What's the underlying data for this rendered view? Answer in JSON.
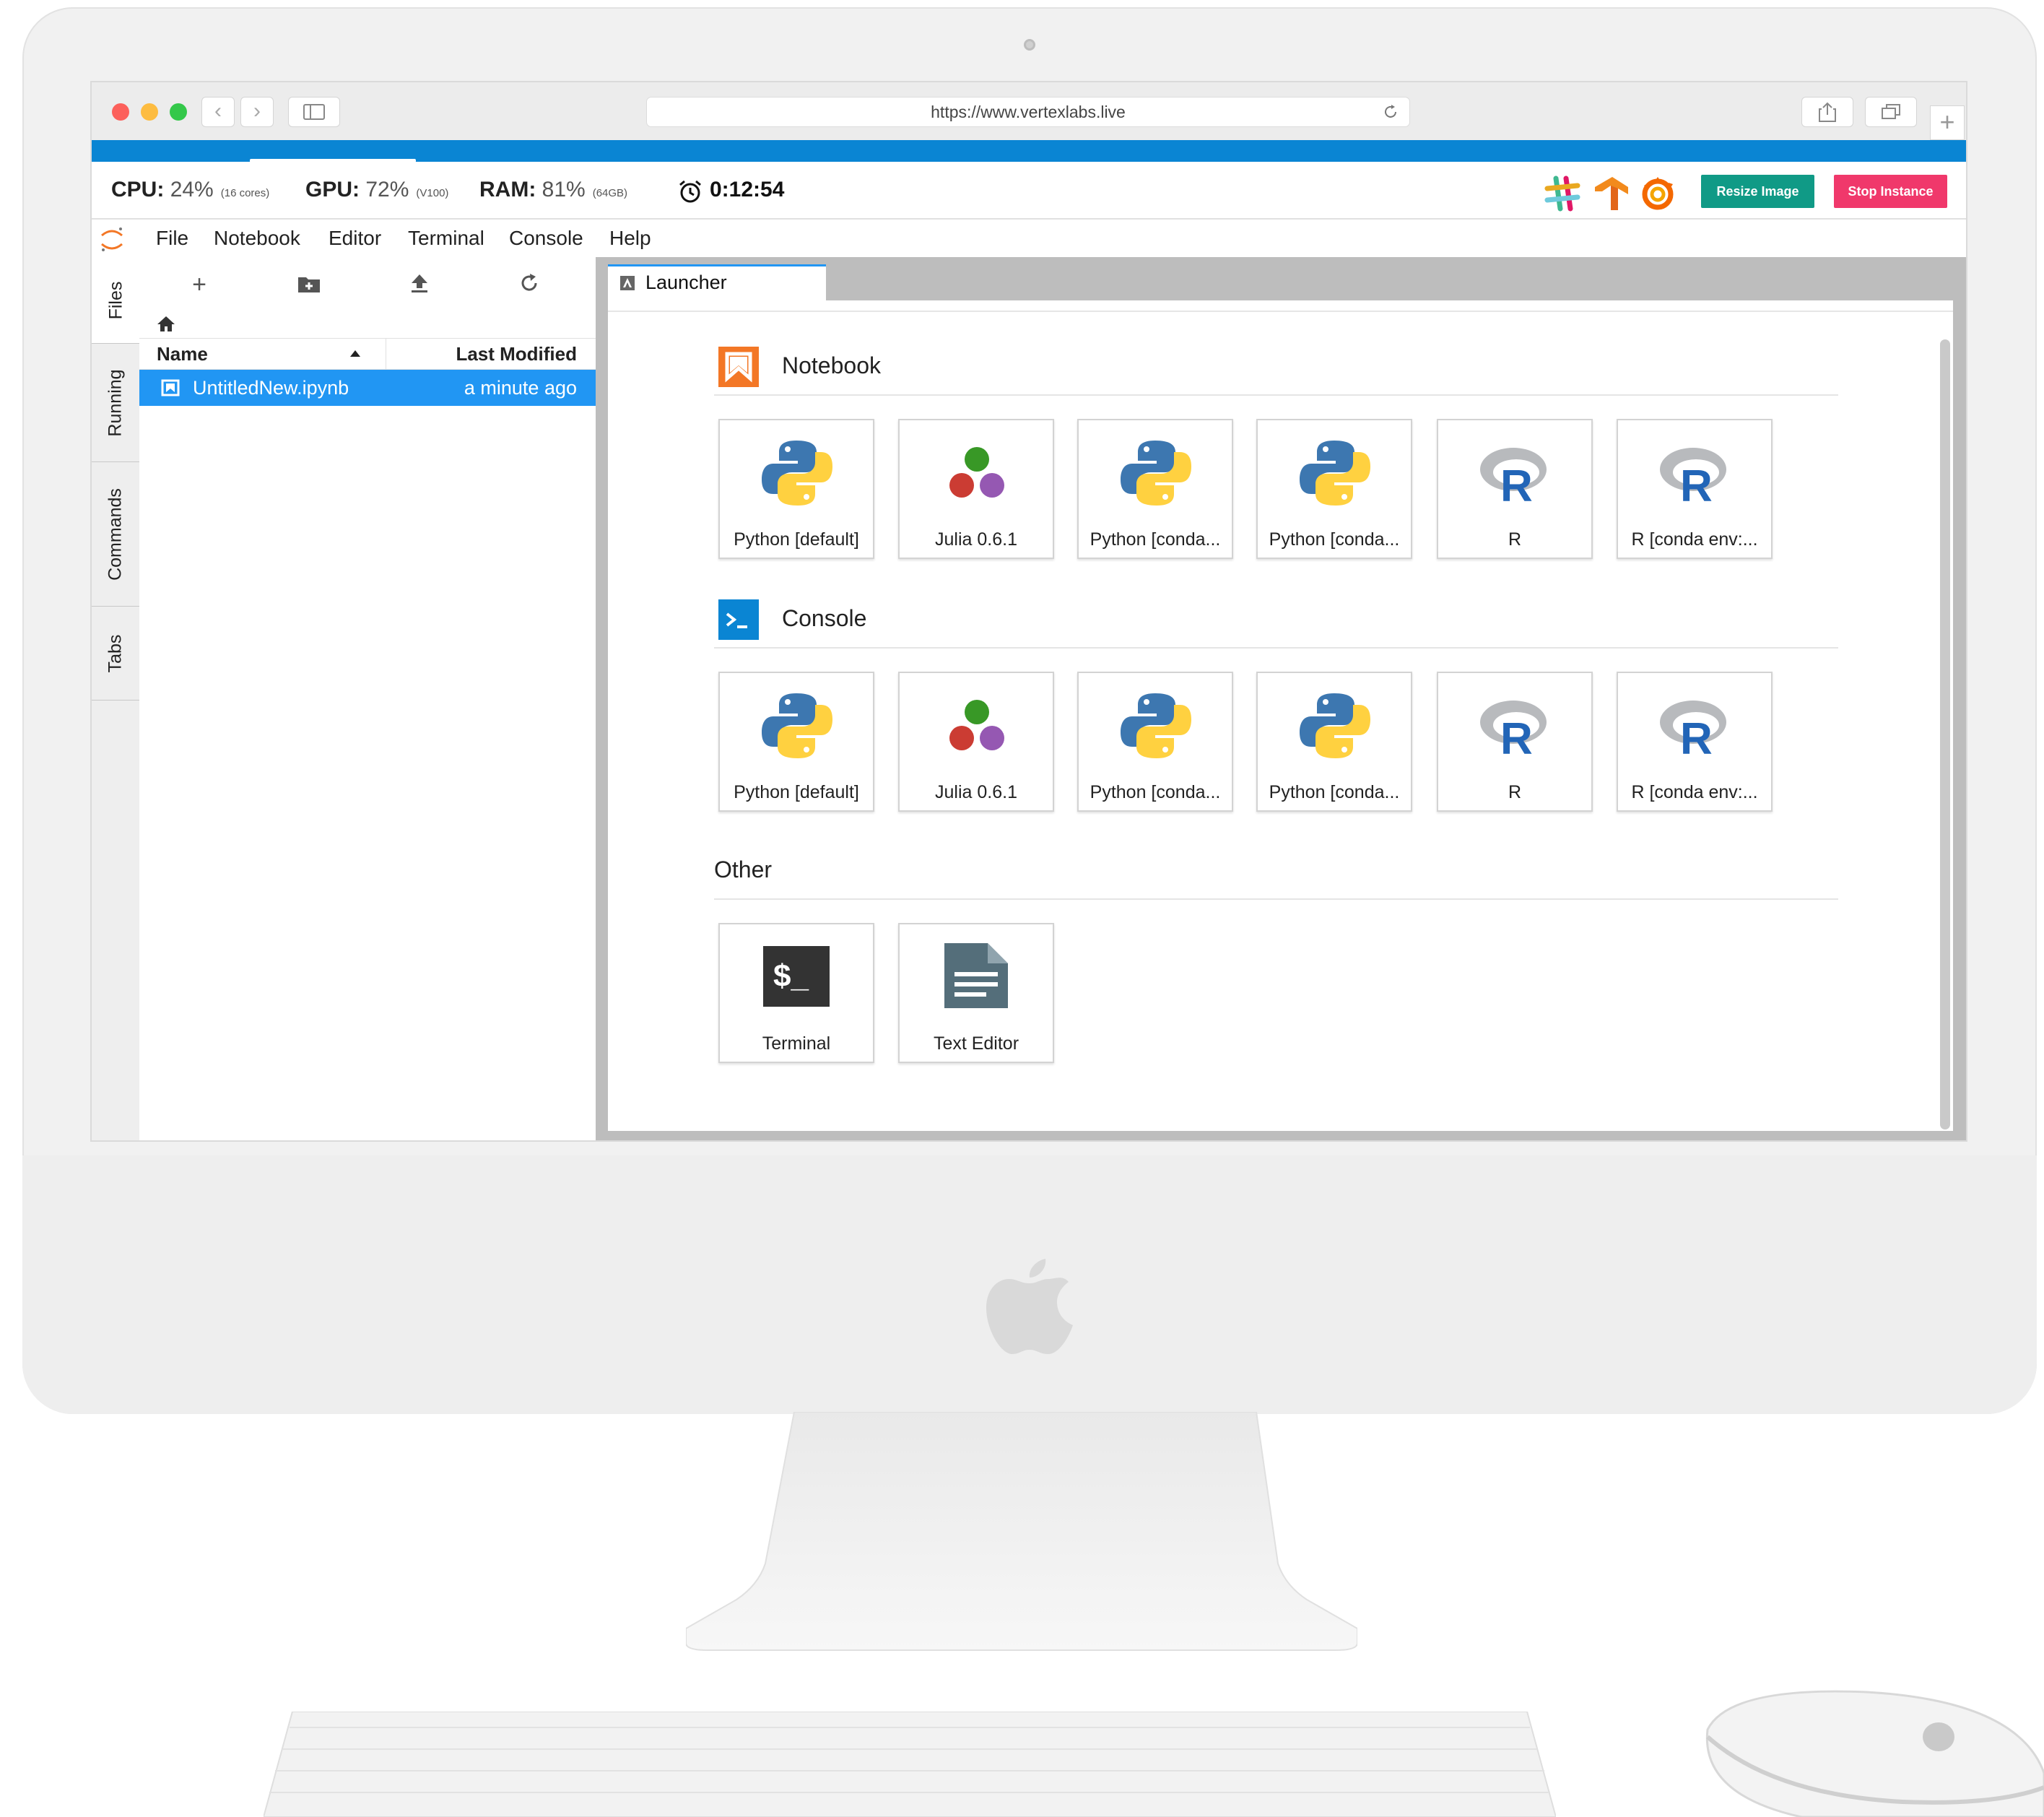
{
  "browser": {
    "url": "https://www.vertexlabs.live"
  },
  "status": {
    "cpu_label": "CPU:",
    "cpu_value": "24%",
    "cpu_detail": "(16 cores)",
    "gpu_label": "GPU:",
    "gpu_value": "72%",
    "gpu_detail": "(V100)",
    "ram_label": "RAM:",
    "ram_value": "81%",
    "ram_detail": "(64GB)",
    "timer": "0:12:54",
    "resize_button": "Resize Image",
    "stop_button": "Stop Instance",
    "colors": {
      "resize": "#109a86",
      "stop": "#f0386b",
      "banner": "#0a85d3"
    }
  },
  "menu": [
    "File",
    "Notebook",
    "Editor",
    "Terminal",
    "Console",
    "Help"
  ],
  "sidebar_tabs": [
    "Files",
    "Running",
    "Commands",
    "Tabs"
  ],
  "file_browser": {
    "columns": {
      "name": "Name",
      "modified": "Last Modified"
    },
    "files": [
      {
        "name": "UntitledNew.ipynb",
        "modified": "a minute ago",
        "selected": true
      }
    ],
    "toolbar_icons": [
      "plus-icon",
      "new-folder-icon",
      "upload-icon",
      "refresh-icon"
    ]
  },
  "launcher": {
    "tab_label": "Launcher",
    "sections": {
      "notebook": {
        "title": "Notebook",
        "icon": "notebook-bookmark-icon",
        "items": [
          "Python [default]",
          "Julia 0.6.1",
          "Python [conda...",
          "Python [conda...",
          "R",
          "R [conda env:..."
        ]
      },
      "console": {
        "title": "Console",
        "icon": "console-prompt-icon",
        "items": [
          "Python [default]",
          "Julia 0.6.1",
          "Python [conda...",
          "Python [conda...",
          "R",
          "R [conda env:..."
        ]
      },
      "other": {
        "title": "Other",
        "items": [
          "Terminal",
          "Text Editor"
        ]
      }
    },
    "item_icons": [
      "python-logo",
      "julia-logo",
      "python-logo",
      "python-logo",
      "r-logo",
      "r-logo"
    ]
  }
}
